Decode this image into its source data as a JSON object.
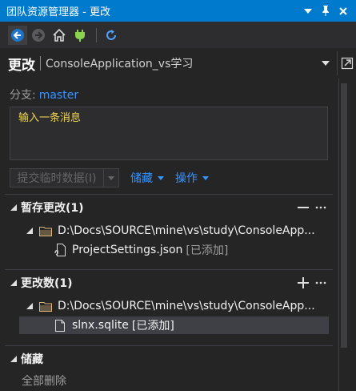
{
  "window": {
    "title": "团队资源管理器 - 更改",
    "buttons": [
      "dropdown-icon",
      "pin-icon",
      "close-icon"
    ]
  },
  "toolbar": {
    "icons": [
      "back-icon",
      "forward-icon",
      "home-icon",
      "connect-icon",
      "refresh-icon"
    ]
  },
  "header": {
    "title": "更改",
    "subtitle": "ConsoleApplication_vs学习"
  },
  "branch": {
    "label": "分支:",
    "name": "master"
  },
  "commit_message": {
    "placeholder": "输入一条消息",
    "value": ""
  },
  "actions": {
    "commit_label": "提交临时数据(I)",
    "stash_label": "储藏",
    "operations_label": "操作"
  },
  "staged": {
    "title": "暂存更改(1)",
    "folder": "D:\\Docs\\SOURCE\\mine\\vs\\study\\ConsoleApp...",
    "file": {
      "name": "ProjectSettings.json",
      "status": "[已添加]"
    }
  },
  "changes": {
    "title": "更改数(1)",
    "folder": "D:\\Docs\\SOURCE\\mine\\vs\\study\\ConsoleApp...",
    "file": {
      "name": "slnx.sqlite",
      "status": "[已添加]"
    }
  },
  "stashes": {
    "title": "储藏",
    "delete_all": "全部删除"
  },
  "colors": {
    "accent": "#007acc",
    "link": "#3794ff",
    "placeholder": "#f0d64f",
    "background": "#252526"
  }
}
